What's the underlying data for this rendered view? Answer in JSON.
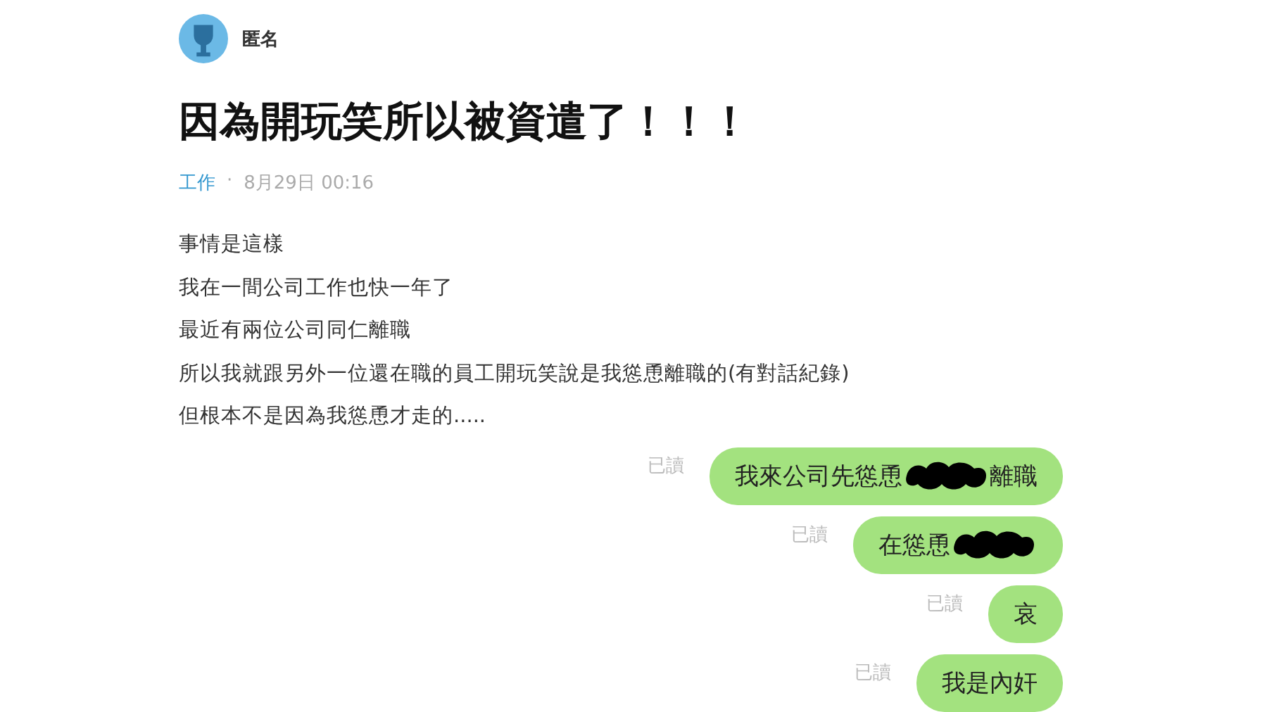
{
  "author": {
    "name": "匿名"
  },
  "title": "因為開玩笑所以被資遣了！！！",
  "meta": {
    "board": "工作",
    "separator": "·",
    "date": "8月29日 00:16"
  },
  "body": [
    "事情是這樣",
    "我在一間公司工作也快一年了",
    "最近有兩位公司同仁離職",
    "所以我就跟另外一位還在職的員工開玩笑說是我慫恿離職的(有對話紀錄)",
    "但根本不是因為我慫恿才走的....."
  ],
  "chat": [
    {
      "status": "已讀",
      "parts": [
        {
          "kind": "text",
          "text": "我來公司先慫恿"
        },
        {
          "kind": "redaction"
        },
        {
          "kind": "text",
          "text": "離職"
        }
      ]
    },
    {
      "status": "已讀",
      "parts": [
        {
          "kind": "text",
          "text": "在慫恿"
        },
        {
          "kind": "redaction"
        }
      ]
    },
    {
      "status": "已讀",
      "parts": [
        {
          "kind": "text",
          "text": "哀"
        }
      ]
    },
    {
      "status": "已讀",
      "parts": [
        {
          "kind": "text",
          "text": "我是內奸"
        }
      ]
    }
  ]
}
